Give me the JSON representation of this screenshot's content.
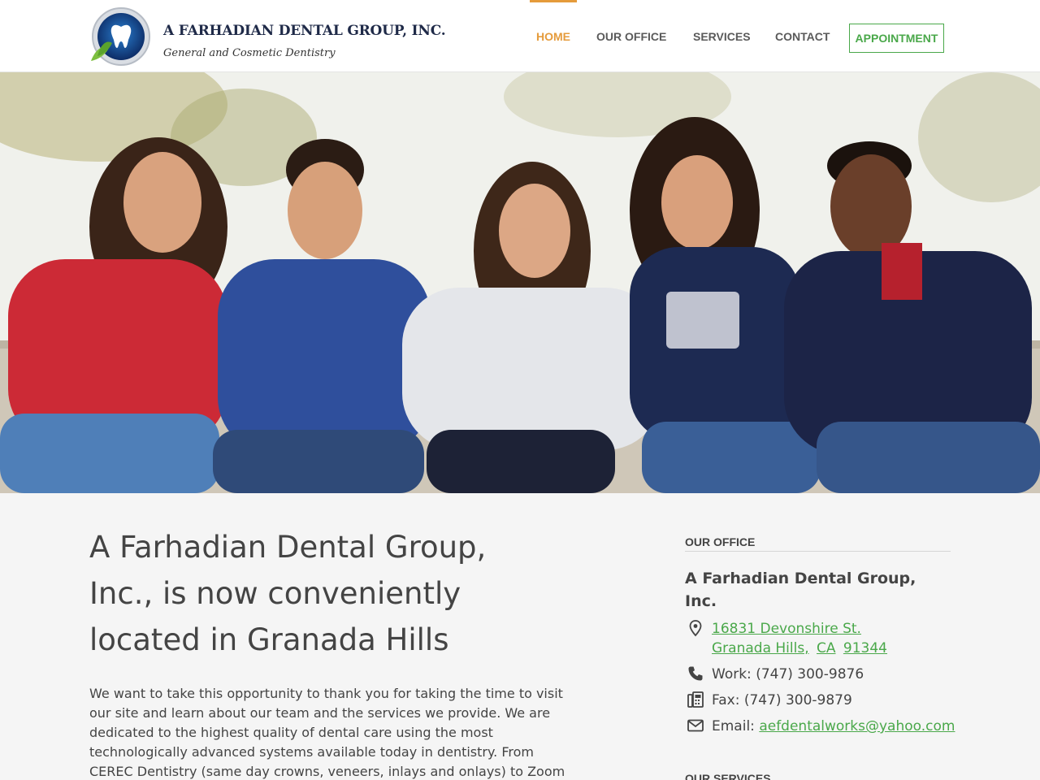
{
  "header": {
    "brand_name": "A FARHADIAN DENTAL GROUP, INC.",
    "brand_tagline": "General and Cosmetic Dentistry",
    "logo_icon": "tooth-leaf-logo-icon",
    "nav": [
      {
        "label": "HOME",
        "active": true
      },
      {
        "label": "OUR OFFICE",
        "active": false
      },
      {
        "label": "SERVICES",
        "active": false
      },
      {
        "label": "CONTACT",
        "active": false
      }
    ],
    "appointment_label": "APPOINTMENT"
  },
  "hero": {
    "image": "group-of-five-smiling-young-people-photo"
  },
  "main": {
    "heading": "A Farhadian Dental Group, Inc., is now conveniently located in Granada Hills",
    "intro": "We want to take this opportunity to thank you for taking the time to visit our site and learn about our team and the services we provide. We are dedicated to the highest quality of dental care using the most technologically advanced systems available today in dentistry. From CEREC Dentistry (same day crowns, veneers, inlays and onlays) to Zoom"
  },
  "sidebar": {
    "office_title": "OUR OFFICE",
    "office_name": "A Farhadian Dental Group, Inc.",
    "address_street": "16831 Devonshire St.",
    "address_city": "Granada Hills,",
    "address_state": "CA",
    "address_zip": "91344",
    "work_label": "Work:",
    "work_phone": "(747) 300-9876",
    "fax_label": "Fax:",
    "fax_phone": "(747) 300-9879",
    "email_label": "Email:",
    "email": "aefdentalworks@yahoo.com",
    "services_title": "OUR SERVICES"
  },
  "colors": {
    "accent_orange": "#e59b3b",
    "accent_green": "#4aa84a",
    "brand_navy": "#1f2a48"
  }
}
